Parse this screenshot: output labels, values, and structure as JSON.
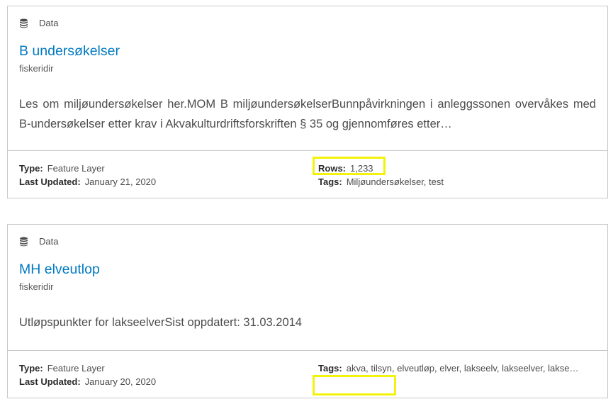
{
  "cards": [
    {
      "kind_label": "Data",
      "kind_icon": "database-icon",
      "title": "B undersøkelser",
      "owner": "fiskeridir",
      "description": "Les om miljøundersøkelser her.MOM B miljøundersøkelserBunnpåvirkningen i anleggssonen overvåkes med B-undersøkelser etter krav i Akvakulturdriftsforskriften § 35 og gjennomføres etter…",
      "type_label": "Type:",
      "type_value": "Feature Layer",
      "updated_label": "Last Updated:",
      "updated_value": "January 21, 2020",
      "rows_label": "Rows:",
      "rows_value": "1,233",
      "tags_label": "Tags:",
      "tags_value": "Miljøundersøkelser, test"
    },
    {
      "kind_label": "Data",
      "kind_icon": "database-icon",
      "title": "MH elveutlop",
      "owner": "fiskeridir",
      "description": "Utløpspunkter for lakseelverSist oppdatert: 31.03.2014",
      "type_label": "Type:",
      "type_value": "Feature Layer",
      "updated_label": "Last Updated:",
      "updated_value": "January 20, 2020",
      "tags_label": "Tags:",
      "tags_value": "akva, tilsyn, elveutløp, elver, lakseelv, lakseelver, lakse…"
    }
  ],
  "colors": {
    "title_link": "#0079c1",
    "border": "#c8c8c8",
    "highlight": "#f2f20a"
  }
}
